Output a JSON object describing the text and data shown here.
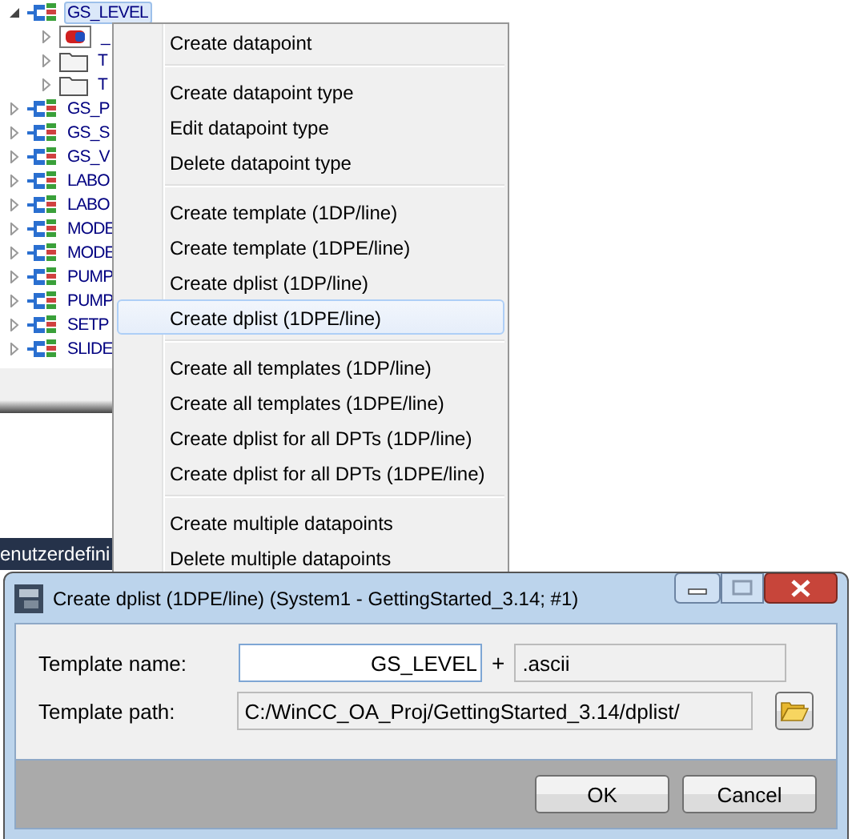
{
  "tree": {
    "items": [
      {
        "label": "GS_LEVEL",
        "kind": "dp-type",
        "expanded": true,
        "selected": true,
        "children": [
          {
            "label": "_",
            "kind": "datapoint",
            "expanded": false,
            "selected": false
          },
          {
            "label": "T",
            "kind": "folder",
            "expanded": false,
            "selected": false
          },
          {
            "label": "T",
            "kind": "folder",
            "expanded": false,
            "selected": false
          }
        ]
      },
      {
        "label": "GS_P",
        "kind": "dp-type",
        "expanded": false,
        "selected": false
      },
      {
        "label": "GS_S",
        "kind": "dp-type",
        "expanded": false,
        "selected": false
      },
      {
        "label": "GS_V",
        "kind": "dp-type",
        "expanded": false,
        "selected": false
      },
      {
        "label": "LABO",
        "kind": "dp-type",
        "expanded": false,
        "selected": false
      },
      {
        "label": "LABO",
        "kind": "dp-type",
        "expanded": false,
        "selected": false
      },
      {
        "label": "MODE",
        "kind": "dp-type",
        "expanded": false,
        "selected": false
      },
      {
        "label": "MODE",
        "kind": "dp-type",
        "expanded": false,
        "selected": false
      },
      {
        "label": "PUMP",
        "kind": "dp-type",
        "expanded": false,
        "selected": false
      },
      {
        "label": "PUMP",
        "kind": "dp-type",
        "expanded": false,
        "selected": false
      },
      {
        "label": "SETP",
        "kind": "dp-type",
        "expanded": false,
        "selected": false
      },
      {
        "label": "SLIDE",
        "kind": "dp-type",
        "expanded": false,
        "selected": false
      }
    ]
  },
  "status_tab": {
    "label": "enutzerdefini"
  },
  "context_menu": {
    "groups": [
      [
        {
          "label": "Create datapoint",
          "selected": false
        }
      ],
      [
        {
          "label": "Create datapoint type",
          "selected": false
        },
        {
          "label": "Edit datapoint type",
          "selected": false
        },
        {
          "label": "Delete datapoint type",
          "selected": false
        }
      ],
      [
        {
          "label": "Create template (1DP/line)",
          "selected": false
        },
        {
          "label": "Create template (1DPE/line)",
          "selected": false
        },
        {
          "label": "Create dplist (1DP/line)",
          "selected": false
        },
        {
          "label": "Create dplist (1DPE/line)",
          "selected": true
        }
      ],
      [
        {
          "label": "Create all templates (1DP/line)",
          "selected": false
        },
        {
          "label": "Create all templates (1DPE/line)",
          "selected": false
        },
        {
          "label": "Create dplist for all DPTs (1DP/line)",
          "selected": false
        },
        {
          "label": "Create dplist for all DPTs (1DPE/line)",
          "selected": false
        }
      ],
      [
        {
          "label": "Create multiple datapoints",
          "selected": false
        },
        {
          "label": "Delete multiple datapoints",
          "selected": false
        }
      ]
    ]
  },
  "dialog": {
    "title": "Create dplist (1DPE/line) (System1 - GettingStarted_3.14; #1)",
    "fields": [
      {
        "label": "Template name:",
        "value": "GS_LEVEL",
        "editable": true,
        "joiner": "+",
        "suffix": ".ascii",
        "browse_button": false
      },
      {
        "label": "Template path:",
        "value": "C:/WinCC_OA_Proj/GettingStarted_3.14/dplist/",
        "editable": false,
        "browse_button": true
      }
    ],
    "buttons": [
      "OK",
      "Cancel"
    ]
  }
}
